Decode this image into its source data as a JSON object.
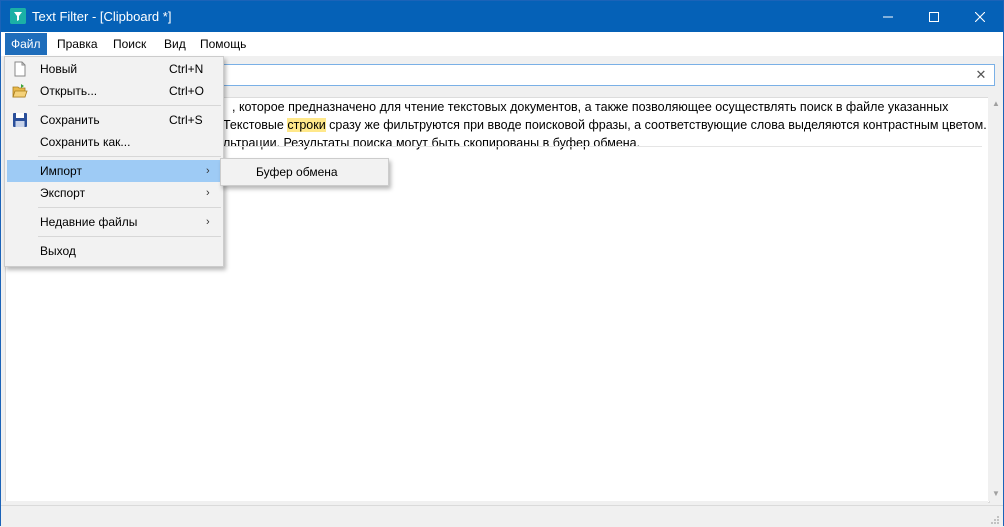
{
  "window": {
    "title": "Text Filter - [Clipboard *]",
    "title_color": "#0561b7"
  },
  "menubar": {
    "items": [
      {
        "label": "Файл",
        "active": true
      },
      {
        "label": "Правка"
      },
      {
        "label": "Поиск"
      },
      {
        "label": "Вид"
      },
      {
        "label": "Помощь"
      }
    ]
  },
  "filter": {
    "value": "",
    "clear_icon": "close-icon"
  },
  "content": {
    "lines": [
      {
        "before": ", которое предназначено для чтение текстовых документов, а также позволяющее осуществлять поиск в файле указанных",
        "highlight": "",
        "after": ""
      },
      {
        "before": "Текстовые ",
        "highlight": "строки",
        "after": " сразу же фильтруются при вводе поисковой фразы, а соответствующие слова выделяются контрастным цветом."
      },
      {
        "before": "ильтрации. Результаты поиска могут быть скопированы в буфер обмена.",
        "highlight": "",
        "after": ""
      }
    ],
    "highlight_color": "#ffe88a"
  },
  "file_menu": {
    "items": [
      {
        "label": "Новый",
        "shortcut": "Ctrl+N",
        "icon": "new-file-icon"
      },
      {
        "label": "Открыть...",
        "shortcut": "Ctrl+O",
        "icon": "open-folder-icon"
      },
      {
        "label": "Сохранить",
        "shortcut": "Ctrl+S",
        "icon": "save-icon"
      },
      {
        "label": "Сохранить как...",
        "shortcut": ""
      },
      {
        "label": "Импорт",
        "submenu": true
      },
      {
        "label": "Экспорт",
        "submenu": true
      },
      {
        "label": "Недавние файлы",
        "submenu": true
      },
      {
        "label": "Выход"
      }
    ],
    "hover_color": "#9ecbf5"
  },
  "import_submenu": {
    "items": [
      {
        "label": "Буфер обмена"
      }
    ]
  }
}
